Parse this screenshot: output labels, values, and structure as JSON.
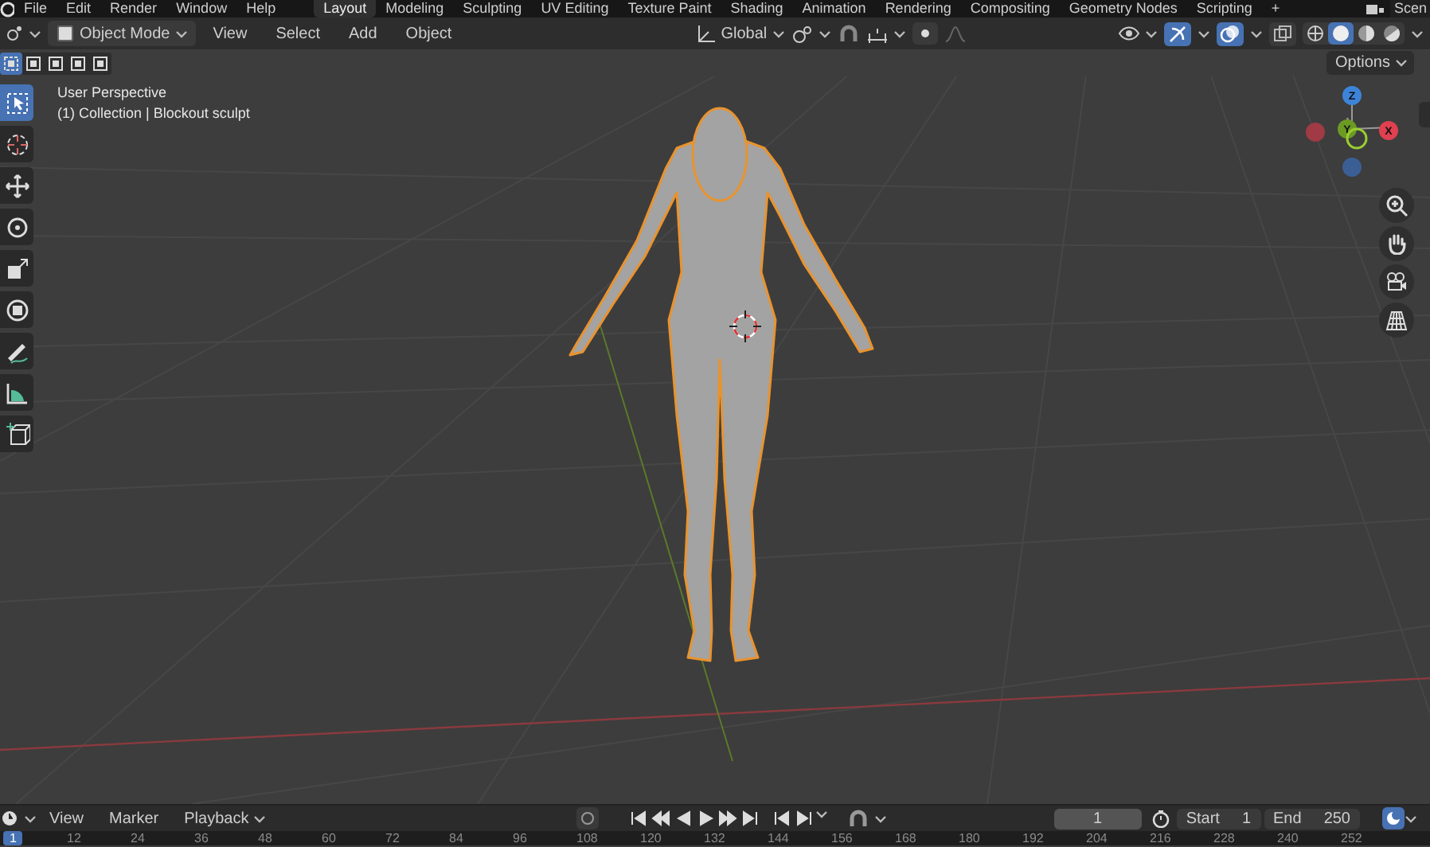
{
  "top_bar": {
    "menus": [
      "File",
      "Edit",
      "Render",
      "Window",
      "Help"
    ],
    "workspaces": [
      {
        "label": "Layout",
        "selected": true
      },
      {
        "label": "Modeling",
        "selected": false
      },
      {
        "label": "Sculpting",
        "selected": false
      },
      {
        "label": "UV Editing",
        "selected": false
      },
      {
        "label": "Texture Paint",
        "selected": false
      },
      {
        "label": "Shading",
        "selected": false
      },
      {
        "label": "Animation",
        "selected": false
      },
      {
        "label": "Rendering",
        "selected": false
      },
      {
        "label": "Compositing",
        "selected": false
      },
      {
        "label": "Geometry Nodes",
        "selected": false
      },
      {
        "label": "Scripting",
        "selected": false
      }
    ],
    "add_tab": "+",
    "scene": "Scen"
  },
  "header": {
    "mode": "Object Mode",
    "menus": [
      "View",
      "Select",
      "Add",
      "Object"
    ],
    "orientation": "Global",
    "gizmos_on": true,
    "overlays_on": true,
    "shading": [
      {
        "kind": "wireframe",
        "selected": false
      },
      {
        "kind": "solid",
        "selected": true
      },
      {
        "kind": "material",
        "selected": false
      },
      {
        "kind": "rendered",
        "selected": false
      }
    ]
  },
  "tool_settings": {
    "select_modes": [
      {
        "selected": true
      },
      {
        "selected": false
      },
      {
        "selected": false
      },
      {
        "selected": false
      },
      {
        "selected": false
      }
    ],
    "options": "Options"
  },
  "viewport": {
    "view_name": "User Perspective",
    "collection": "(1) Collection | Blockout sculpt",
    "tools": [
      {
        "kind": "select",
        "selected": true
      },
      {
        "kind": "cursor",
        "selected": false
      },
      {
        "kind": "move",
        "selected": false
      },
      {
        "kind": "rotate",
        "selected": false
      },
      {
        "kind": "scale",
        "selected": false
      },
      {
        "kind": "transform",
        "selected": false
      },
      {
        "kind": "annotate",
        "selected": false
      },
      {
        "kind": "measure",
        "selected": false
      },
      {
        "kind": "add-cube",
        "selected": false
      }
    ],
    "gizmo": {
      "z": "Z",
      "y": "Y",
      "x": "X"
    }
  },
  "timeline": {
    "menus": [
      "View",
      "Marker",
      "Playback"
    ],
    "auto_keying": false,
    "current_frame": "1",
    "start_label": "Start",
    "start": "1",
    "end_label": "End",
    "end": "250",
    "ruler": [
      {
        "label": "1",
        "selected": true
      },
      {
        "label": "12",
        "selected": false
      },
      {
        "label": "24",
        "selected": false
      },
      {
        "label": "36",
        "selected": false
      },
      {
        "label": "48",
        "selected": false
      },
      {
        "label": "60",
        "selected": false
      },
      {
        "label": "72",
        "selected": false
      },
      {
        "label": "84",
        "selected": false
      },
      {
        "label": "96",
        "selected": false
      },
      {
        "label": "108",
        "selected": false
      },
      {
        "label": "120",
        "selected": false
      },
      {
        "label": "132",
        "selected": false
      },
      {
        "label": "144",
        "selected": false
      },
      {
        "label": "156",
        "selected": false
      },
      {
        "label": "168",
        "selected": false
      },
      {
        "label": "180",
        "selected": false
      },
      {
        "label": "192",
        "selected": false
      },
      {
        "label": "204",
        "selected": false
      },
      {
        "label": "216",
        "selected": false
      },
      {
        "label": "228",
        "selected": false
      },
      {
        "label": "240",
        "selected": false
      },
      {
        "label": "252",
        "selected": false
      }
    ]
  }
}
